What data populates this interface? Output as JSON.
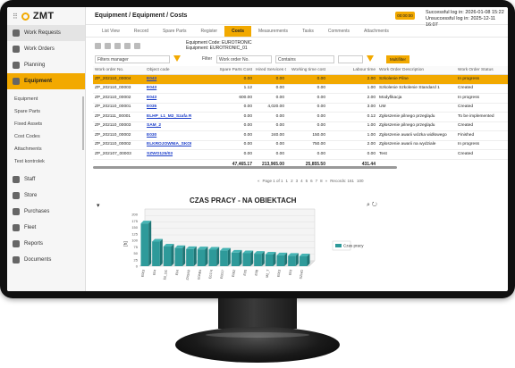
{
  "app": {
    "logo": "ZMT",
    "grip_icon": "grip-dots-icon"
  },
  "sidebar": {
    "items": [
      {
        "label": "Work Requests",
        "icon": "requests-icon",
        "state": "hl"
      },
      {
        "label": "Work Orders",
        "icon": "orders-icon",
        "state": ""
      },
      {
        "label": "Planning",
        "icon": "calendar-icon",
        "state": ""
      },
      {
        "label": "Equipment",
        "icon": "gears-icon",
        "state": "active"
      }
    ],
    "sub_items": [
      "Equipment",
      "Spare Parts",
      "Fixed Assets",
      "Cost Codes",
      "Attachments",
      "Test kontrolek"
    ],
    "items2": [
      {
        "label": "Staff",
        "icon": "people-icon"
      },
      {
        "label": "Store",
        "icon": "store-icon"
      },
      {
        "label": "Purchases",
        "icon": "cart-icon"
      },
      {
        "label": "Fleet",
        "icon": "truck-icon"
      },
      {
        "label": "Reports",
        "icon": "report-icon"
      },
      {
        "label": "Documents",
        "icon": "document-icon"
      }
    ]
  },
  "header": {
    "breadcrumb": "Equipment / Equipment / Costs",
    "chip": "00:00:00",
    "login_success": "Successful log in: 2026-01-08 15:22",
    "login_fail": "Unsuccessful log in: 2025-12-11 16:07"
  },
  "tabs": [
    {
      "label": "List View",
      "active": false
    },
    {
      "label": "Record",
      "active": false
    },
    {
      "label": "Spare Parts",
      "active": false
    },
    {
      "label": "Register",
      "active": false
    },
    {
      "label": "Costs",
      "active": true
    },
    {
      "label": "Measurements",
      "active": false
    },
    {
      "label": "Tasks",
      "active": false
    },
    {
      "label": "Comments",
      "active": false
    },
    {
      "label": "Attachments",
      "active": false
    }
  ],
  "equipment": {
    "code_line": "Equipment Code: EUROTRONIC",
    "name_line": "Equipment: EUROTRONIC_01"
  },
  "filters": {
    "manager_placeholder": "Filters manager",
    "filter_label": "Filter",
    "field": "Work order No.",
    "op": "Contains",
    "multifilter": "Multifilter"
  },
  "table": {
    "columns": [
      "Work order No.",
      "Object code",
      "Spare Parts Cost",
      "Hired Services Cost",
      "Working time cost",
      "Labour time",
      "Work Order Description",
      "Work Order Status"
    ],
    "rows": [
      [
        "ZP_202110_00004",
        "E043",
        "0.00",
        "0.00",
        "0.00",
        "2.00",
        "Szkolenie Pilne",
        "In progress"
      ],
      [
        "ZP_202110_00003",
        "E043",
        "1.12",
        "0.00",
        "0.00",
        "1.00",
        "Szkolenie Szkolenie Standard 1",
        "Created"
      ],
      [
        "ZP_202110_00002",
        "E043",
        "600.00",
        "0.00",
        "0.00",
        "2.00",
        "Modyfikacja",
        "In progress"
      ],
      [
        "ZP_202110_00001",
        "E035",
        "0.00",
        "4,020.00",
        "0.00",
        "3.00",
        "UM",
        "Created"
      ],
      [
        "ZP_202111_00001",
        "ELHP_L1_M2_Szafa Rozdz",
        "0.00",
        "0.00",
        "0.00",
        "0.12",
        "Zgłoszenie pilnego przeglądu",
        "To be implemented"
      ],
      [
        "ZP_202110_00003",
        "SAM_2",
        "0.00",
        "0.00",
        "0.00",
        "1.00",
        "Zgłoszenie pilnego przeglądu",
        "Created"
      ],
      [
        "ZP_202110_00002",
        "E030",
        "0.00",
        "240.00",
        "150.00",
        "1.00",
        "Zgłoszenie awarii wózka widłowego",
        "Finished"
      ],
      [
        "ZP_202110_00002",
        "ELKROJOWNIA_SKORY",
        "0.00",
        "0.00",
        "750.00",
        "2.00",
        "Zgłoszenie awarii na wydziale",
        "In progress"
      ],
      [
        "ZP_202107_00003",
        "SZWO125/03",
        "0.00",
        "0.00",
        "0.00",
        "0.00",
        "Test",
        "Created"
      ]
    ],
    "selected_row": 0,
    "link_col": 1,
    "totals": [
      "",
      "",
      "47,465.17",
      "213,965.00",
      "25,855.50",
      "431.44",
      "",
      ""
    ]
  },
  "pager": {
    "text": "Page 1 of 1",
    "pages": [
      "1",
      "2",
      "3",
      "4",
      "5",
      "6",
      "7",
      "8"
    ],
    "records": "Records: 161",
    "size": "100"
  },
  "chart_data": {
    "type": "bar",
    "title": "CZAS PRACY - NA OBIEKTACH",
    "ylabel": "[h]",
    "ylim": [
      0,
      200
    ],
    "yticks": [
      "0",
      "25",
      "50",
      "75",
      "100",
      "125",
      "150",
      "175",
      "200"
    ],
    "categories": [
      "E003",
      "E04",
      "E0_DC",
      "E04",
      "ZASAD",
      "E0AB4",
      "E0174",
      "E0017",
      "E062",
      "E0S",
      "E0B",
      "M2_T",
      "E003",
      "E03",
      "SZWO"
    ],
    "series": [
      {
        "name": "Czas pracy",
        "values": [
          165,
          95,
          76,
          70,
          66,
          65,
          64,
          60,
          52,
          50,
          48,
          45,
          42,
          40,
          38
        ]
      }
    ],
    "legend": "right",
    "colors": {
      "bar": "#2e9a9a",
      "bar_top": "#46b4b4",
      "bar_side": "#1f7575"
    },
    "zoom_icon": "magnifier-icon",
    "refresh_icon": "refresh-icon"
  }
}
